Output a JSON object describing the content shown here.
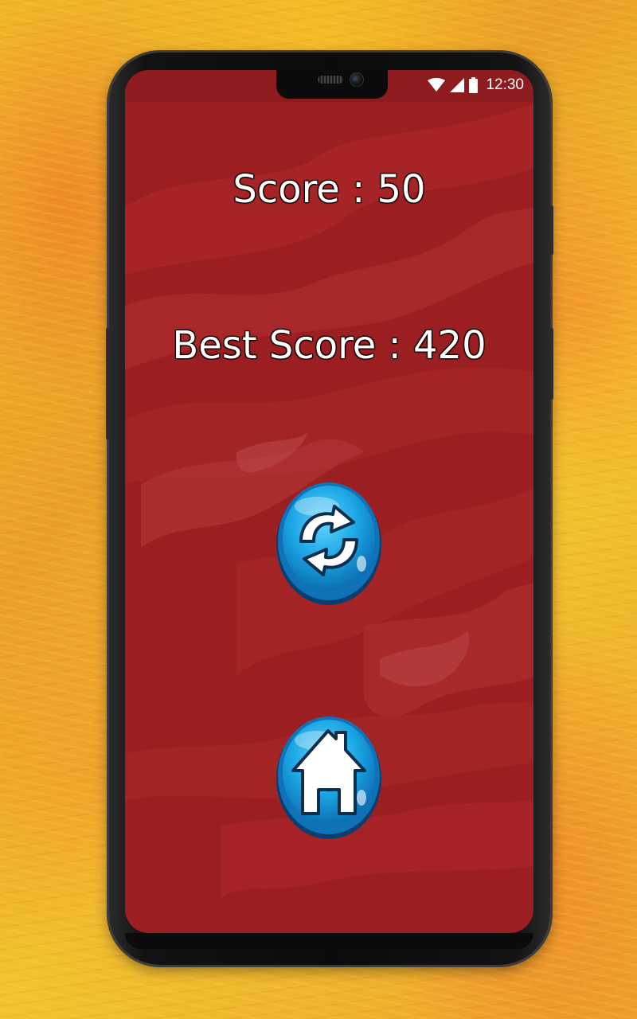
{
  "game_over": {
    "score_text": "Score : 50",
    "best_score_text": "Best Score : 420",
    "score": 50,
    "best_score": 420
  },
  "status_bar": {
    "time": "12:30",
    "icons": [
      "wifi-icon",
      "cellular-signal-icon",
      "battery-icon"
    ]
  },
  "buttons": {
    "restart_icon": "restart-icon",
    "home_icon": "home-icon"
  },
  "colors": {
    "screen_background": "#9b1e20",
    "button_blue": "#1ea7e1",
    "text": "#ffffff",
    "backdrop": "#f0b62a"
  }
}
